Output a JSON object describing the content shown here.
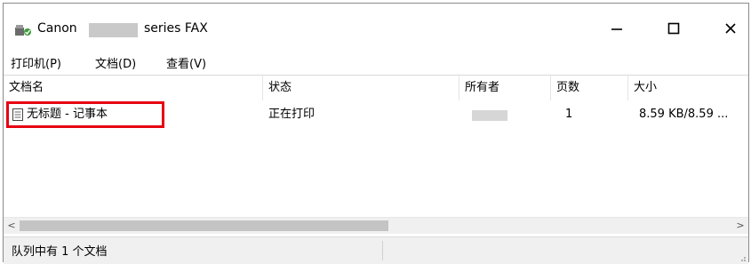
{
  "window": {
    "title_prefix": "Canon",
    "title_suffix": "series FAX",
    "buttons": {
      "minimize": "—",
      "maximize": "☐",
      "close": "✕"
    }
  },
  "menu": [
    {
      "label": "打印机(P)"
    },
    {
      "label": "文档(D)"
    },
    {
      "label": "查看(V)"
    }
  ],
  "columns": [
    "文档名",
    "状态",
    "所有者",
    "页数",
    "大小"
  ],
  "rows": [
    {
      "name": "无标题 - 记事本",
      "status": "正在打印",
      "owner": "",
      "pages": "1",
      "size": "8.59 KB/8.59 ..."
    }
  ],
  "scrollbar": {
    "left_arrow": "<",
    "right_arrow": ">"
  },
  "status_bar": {
    "text": "队列中有 1 个文档"
  },
  "colors": {
    "highlight": "#e60012",
    "redaction": "#c9c9c9"
  }
}
